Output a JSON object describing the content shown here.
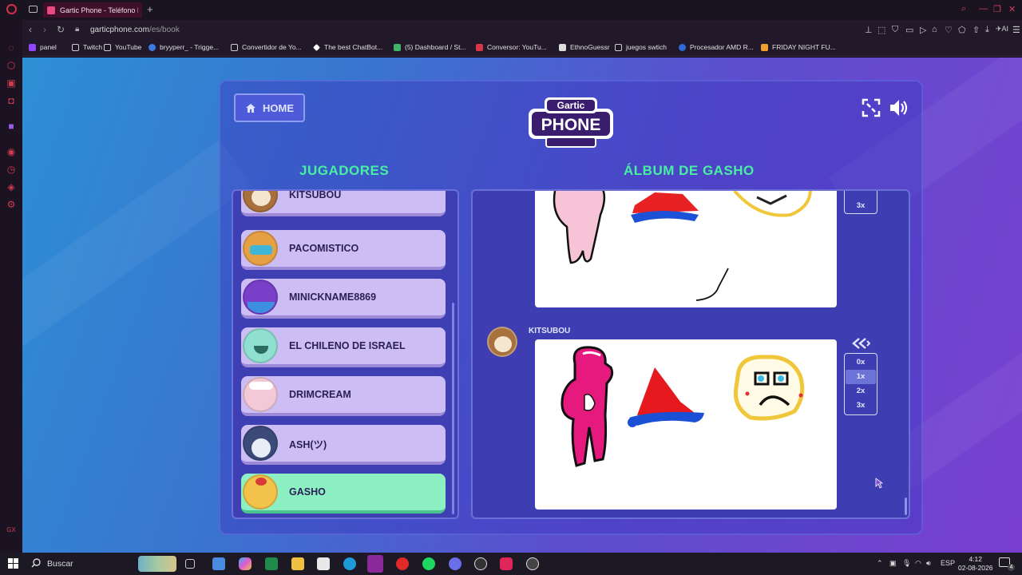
{
  "browser": {
    "tab_title": "Gartic Phone - Teléfono De",
    "url_host": "garticphone.com",
    "url_path": "/es/book",
    "bookmarks": [
      {
        "label": "panel"
      },
      {
        "label": "Twitch"
      },
      {
        "label": "YouTube"
      },
      {
        "label": "bryyperr_ - Trigge..."
      },
      {
        "label": "Convertidor de Yo..."
      },
      {
        "label": "The best ChatBot..."
      },
      {
        "label": "(5) Dashboard / St..."
      },
      {
        "label": "Conversor: YouTu..."
      },
      {
        "label": "EthnoGuessr"
      },
      {
        "label": "juegos swtich"
      },
      {
        "label": "Procesador AMD R..."
      },
      {
        "label": "FRIDAY NIGHT FU..."
      }
    ],
    "ai_label": "AI"
  },
  "game": {
    "home_label": "HOME",
    "logo_top": "Gartic",
    "logo_bottom": "PHONE",
    "players_title": "JUGADORES",
    "album_title": "ÁLBUM DE GASHO",
    "players": [
      {
        "name": "KITSUBOU"
      },
      {
        "name": "PACOMISTICO"
      },
      {
        "name": "MINICKNAME8869"
      },
      {
        "name": "EL CHILENO DE ISRAEL"
      },
      {
        "name": "DRIMCREAM"
      },
      {
        "name": "ASH(ツ)"
      },
      {
        "name": "GASHO"
      }
    ],
    "album_entry_author": "KITSUBOU",
    "speeds_top": [
      "3x"
    ],
    "speeds": [
      "0x",
      "1x",
      "2x",
      "3x"
    ],
    "selected_speed": "1x"
  },
  "taskbar": {
    "search_label": "Buscar",
    "lang": "ESP",
    "time": "4:12",
    "date": "02-08-2026",
    "notification_count": "4"
  },
  "colors": {
    "accent_green": "#47f0a0",
    "player_card": "#cdbdf5",
    "active_player": "#8df0c3"
  }
}
